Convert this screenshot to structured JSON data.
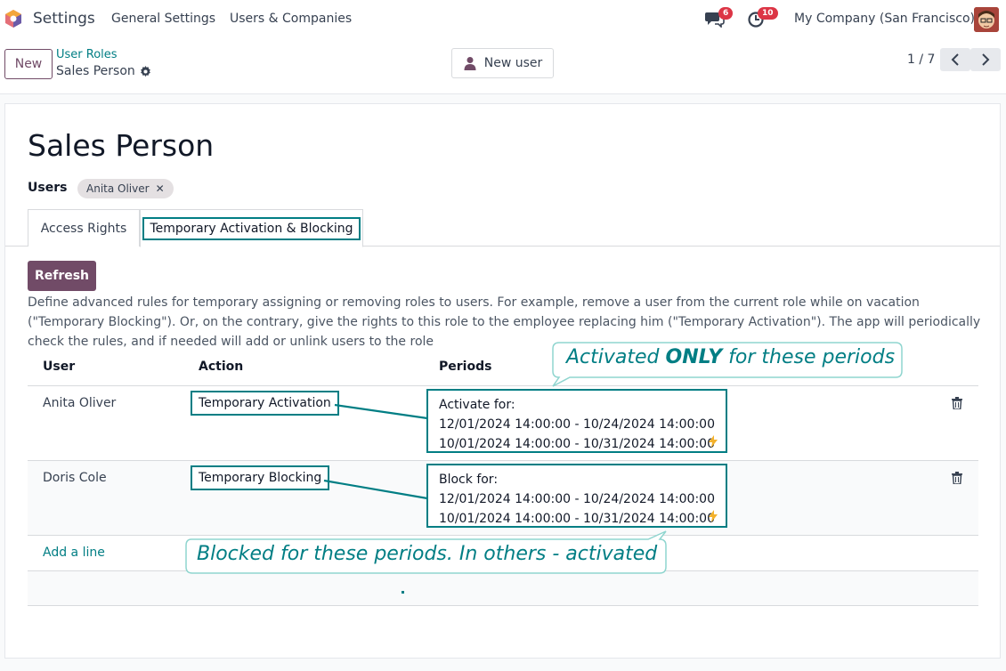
{
  "navbar": {
    "app_name": "Settings",
    "menu": [
      "General Settings",
      "Users & Companies"
    ],
    "messages_count": "6",
    "activities_count": "10",
    "company": "My Company (San Francisco)"
  },
  "control": {
    "new_label": "New",
    "breadcrumb_parent": "User Roles",
    "breadcrumb_current": "Sales Person",
    "new_user_label": "New user",
    "pager": "1 / 7"
  },
  "form": {
    "title": "Sales Person",
    "users_label": "Users",
    "user_tag": "Anita Oliver",
    "tabs": [
      "Access Rights",
      "Temporary Activation & Blocking"
    ],
    "refresh_label": "Refresh",
    "description": "Define advanced rules for temporary assigning or removing roles to users. For example, remove a user from the current role while on vacation (\"Temporary Blocking\"). Or, on the contrary, give the rights to this role to the employee replacing him (\"Temporary Activation\"). The app will periodically check the rules, and if needed will add or unlink users to the role"
  },
  "table": {
    "headers": [
      "User",
      "Action",
      "Periods"
    ],
    "rows": [
      {
        "user": "Anita Oliver",
        "action": "Temporary Activation",
        "periods_title": "Activate for:",
        "periods": [
          "12/01/2024 14:00:00 - 10/24/2024 14:00:00",
          "10/01/2024 14:00:00 - 10/31/2024 14:00:00"
        ]
      },
      {
        "user": "Doris Cole",
        "action": "Temporary Blocking",
        "periods_title": "Block for:",
        "periods": [
          "12/01/2024 14:00:00 - 10/24/2024 14:00:00",
          "10/01/2024 14:00:00 - 10/31/2024 14:00:00"
        ]
      }
    ],
    "add_line": "Add a line"
  },
  "callouts": {
    "activated_pre": "Activated ",
    "activated_bold": "ONLY",
    "activated_post": " for these periods",
    "blocked": "Blocked for these periods. In others - activated"
  },
  "colors": {
    "brand": "#714b67",
    "accent": "#017e84",
    "badge": "#dc3545"
  }
}
